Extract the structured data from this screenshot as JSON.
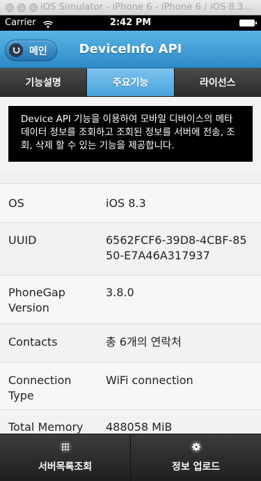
{
  "simulator": {
    "title": "iOS Simulator - iPhone 6 - iPhone 6 / iOS 8.3..."
  },
  "status_bar": {
    "carrier": "Carrier",
    "time": "2:42 PM"
  },
  "header": {
    "back_label": "메인",
    "title": "DeviceInfo API",
    "accent_color": "#3a9ad5"
  },
  "tabs": [
    {
      "label": "기능설명",
      "active": false
    },
    {
      "label": "주요기능",
      "active": true
    },
    {
      "label": "라이선스",
      "active": false
    }
  ],
  "description": {
    "text": "Device API 기능을 이용하여 모바일 디바이스의 메타 데이터 정보를 조회하고 조회된 정보를 서버에 전송, 조회, 삭제 할 수 있는 기능을 제공합니다."
  },
  "info": {
    "rows": [
      {
        "label": "OS",
        "value": "iOS 8.3"
      },
      {
        "label": "UUID",
        "value": "6562FCF6-39D8-4CBF-8550-E7A46A317937"
      },
      {
        "label": "PhoneGap Version",
        "value": "3.8.0"
      },
      {
        "label": "Contacts",
        "value": "총 6개의 연락처"
      },
      {
        "label": "Connection Type",
        "value": "WiFi connection"
      },
      {
        "label": "Total Memory",
        "value": "488058 MiB"
      }
    ]
  },
  "bottom_bar": {
    "left_label": "서버목록조회",
    "left_icon": "grid-icon",
    "right_label": "정보 업로드",
    "right_icon": "gear-icon"
  }
}
